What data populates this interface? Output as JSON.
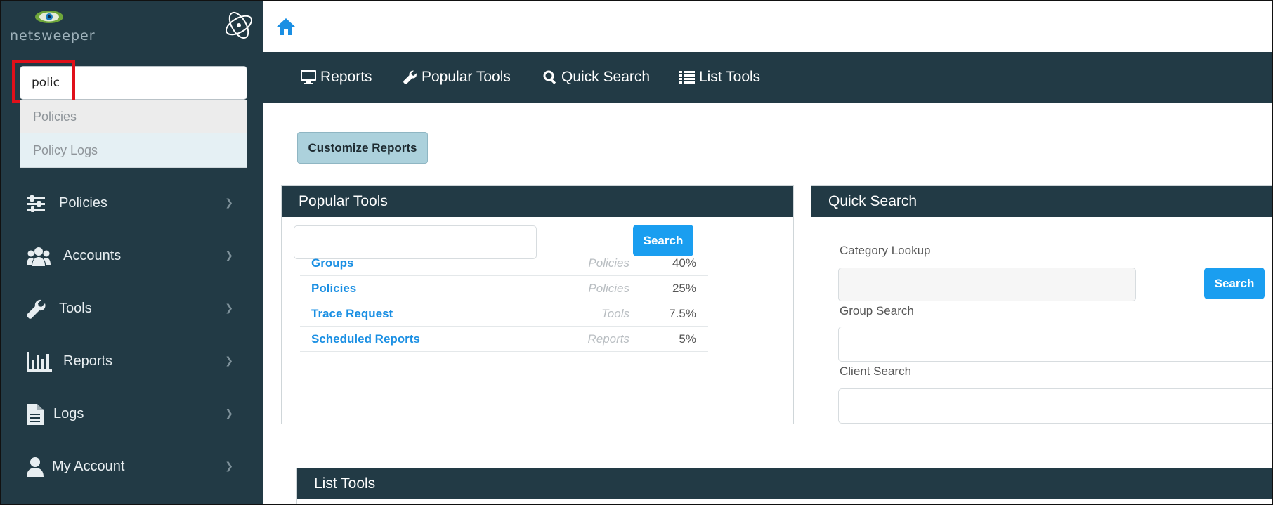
{
  "sidebar": {
    "logo_text": "netsweeper",
    "search": {
      "value": "polic",
      "placeholder": ""
    },
    "autocomplete": [
      {
        "label": "Policies"
      },
      {
        "label": "Policy Logs"
      }
    ],
    "nav": [
      {
        "label": "Policies",
        "icon": "sliders-icon"
      },
      {
        "label": "Accounts",
        "icon": "users-icon"
      },
      {
        "label": "Tools",
        "icon": "wrench-icon"
      },
      {
        "label": "Reports",
        "icon": "bar-chart-icon"
      },
      {
        "label": "Logs",
        "icon": "document-icon"
      },
      {
        "label": "My Account",
        "icon": "user-icon"
      }
    ]
  },
  "menubar": {
    "items": [
      {
        "label": "Reports",
        "icon": "monitor-icon"
      },
      {
        "label": "Popular Tools",
        "icon": "wrench-icon"
      },
      {
        "label": "Quick Search",
        "icon": "search-icon"
      },
      {
        "label": "List Tools",
        "icon": "list-icon"
      }
    ]
  },
  "main": {
    "customize_label": "Customize Reports",
    "popular_tools": {
      "title": "Popular Tools",
      "search_label": "Search",
      "rows": [
        {
          "name": "Groups",
          "category": "Policies",
          "percent": "40%"
        },
        {
          "name": "Policies",
          "category": "Policies",
          "percent": "25%"
        },
        {
          "name": "Trace Request",
          "category": "Tools",
          "percent": "7.5%"
        },
        {
          "name": "Scheduled Reports",
          "category": "Reports",
          "percent": "5%"
        }
      ]
    },
    "quick_search": {
      "title": "Quick Search",
      "category_label": "Category Lookup",
      "search_label": "Search",
      "group_label": "Group Search",
      "client_label": "Client Search"
    },
    "list_tools": {
      "title": "List Tools"
    }
  },
  "colors": {
    "sidebar_bg": "#223a45",
    "accent_blue": "#1a9ef0",
    "link_blue": "#1a8fe3",
    "highlight_red": "#e0101a"
  }
}
